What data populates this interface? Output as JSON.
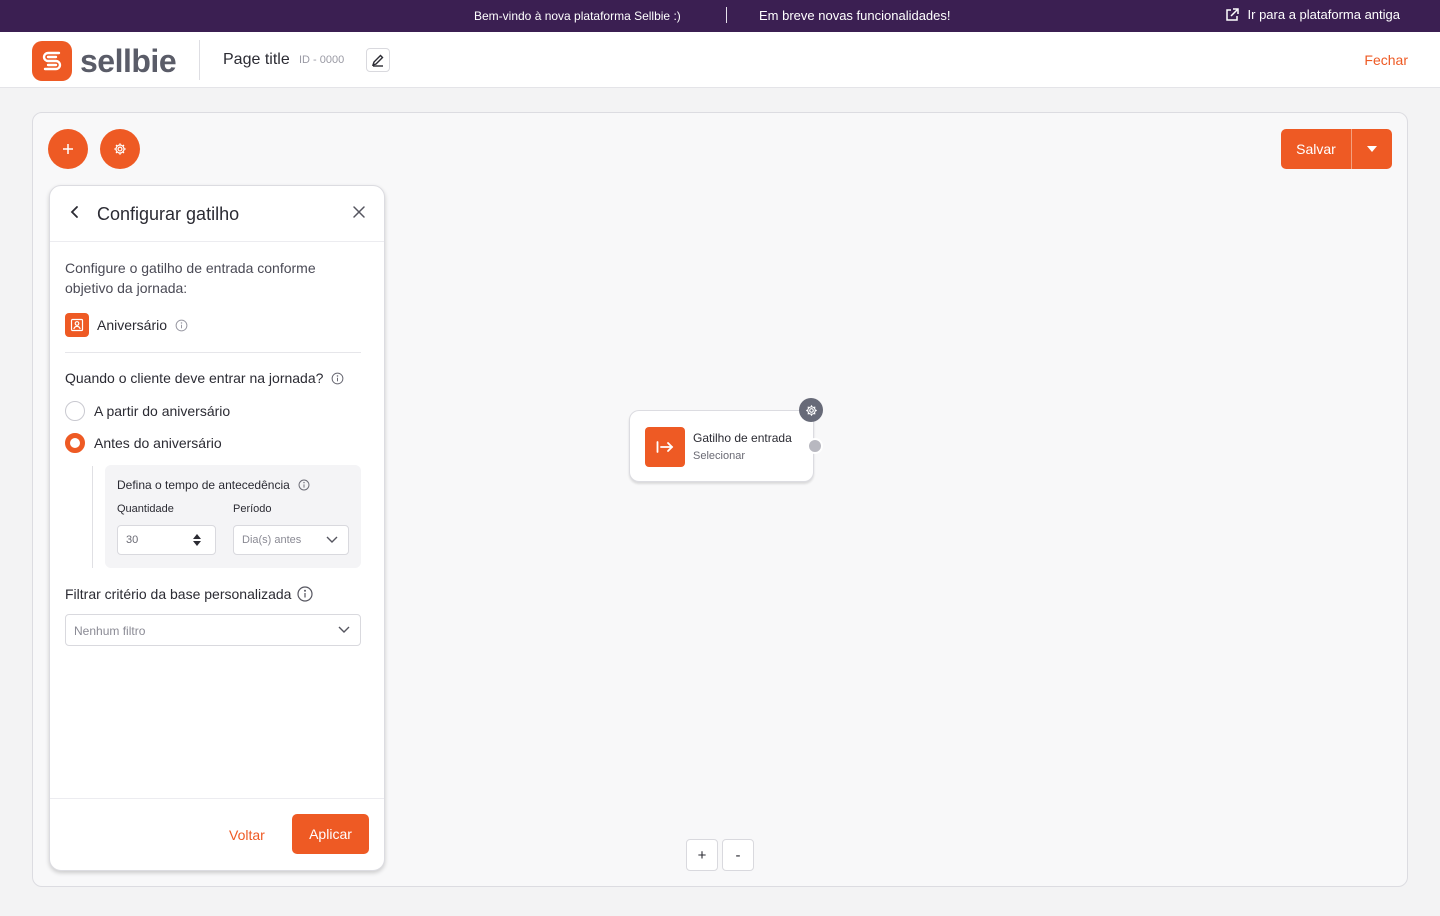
{
  "announcement": {
    "welcome": "Bem-vindo à nova plataforma Sellbie :)",
    "coming_soon": "Em breve novas funcionalidades!",
    "old_platform_link": "Ir para a plataforma antiga"
  },
  "header": {
    "brand": "sellbie",
    "page_title": "Page title",
    "page_id": "ID - 0000",
    "close_label": "Fechar"
  },
  "toolbar": {
    "save_label": "Salvar"
  },
  "panel": {
    "title": "Configurar gatilho",
    "intro": "Configure o gatilho de entrada conforme objetivo da jornada:",
    "trigger_type": "Aniversário",
    "question": "Quando o cliente deve entrar na jornada?",
    "options": [
      {
        "label": "A partir do aniversário",
        "selected": false
      },
      {
        "label": "Antes do aniversário",
        "selected": true
      }
    ],
    "advance": {
      "title": "Defina o tempo de antecedência",
      "quantity_label": "Quantidade",
      "quantity_value": "30",
      "period_label": "Período",
      "period_placeholder": "Dia(s) antes"
    },
    "filter_label": "Filtrar critério da base personalizada",
    "filter_placeholder": "Nenhum filtro",
    "back_label": "Voltar",
    "apply_label": "Aplicar"
  },
  "node": {
    "title": "Gatilho de entrada",
    "subtitle": "Selecionar"
  },
  "zoom": {
    "in": "+",
    "out": "-"
  },
  "colors": {
    "accent": "#ee5a24",
    "topbar": "#3b1f52"
  }
}
